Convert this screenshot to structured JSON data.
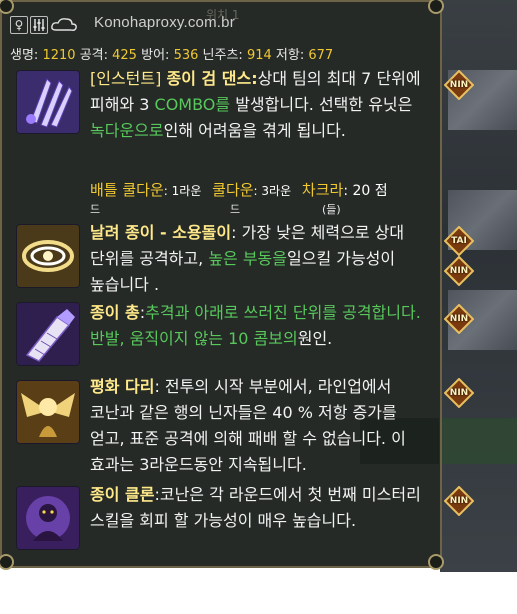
{
  "header": {
    "watermark": "Konohaproxy.com.br",
    "bg_title": "위치 1",
    "icons": [
      "female-icon",
      "equalizer-icon",
      "cloud-icon"
    ]
  },
  "stats": [
    {
      "label": "생명:",
      "value": "1210"
    },
    {
      "label": "공격:",
      "value": "425"
    },
    {
      "label": "방어:",
      "value": "536"
    },
    {
      "label": "닌주츠:",
      "value": "914"
    },
    {
      "label": "저항:",
      "value": "677"
    }
  ],
  "skills": [
    {
      "tag": "[인스턴트]",
      "name": "종이 검 댄스:",
      "text_a": "상대 팀의 최대 7 단위에 피해와 3 ",
      "hl_a": "COMBO를",
      "text_b": " 발생합니다. 선택한 유닛은 ",
      "hl_b": "녹다운으로",
      "text_c": "인해 어려움을 겪게 됩니다.",
      "badge": "NIN"
    },
    {
      "name": "날려 종이 - 소용돌이",
      "text_a": ": 가장 낮은 체력으로 상대 단위를 공격하고, ",
      "hl_a": "높은 부동을",
      "text_b": "일으킬 가능성이 높습니다 .",
      "badge_a": "TAI",
      "badge_b": "NIN"
    },
    {
      "name": "종이 총",
      "text_a": ":",
      "hl_a": "추격과 아래로 쓰러진 단위를 공격합니다. 반발, 움직이지 않는 10 콤보의",
      "text_b": "원인.",
      "badge": "NIN"
    },
    {
      "name": "평화 다리",
      "text_a": ": 전투의 시작 부분에서, 라인업에서 코난과 같은 행의 닌자들은 40 % 저항 증가를 얻고, 표준 공격에 의해 패배 할 수 없습니다. 이 효과는 3라운드동안 지속됩니다.",
      "badge": "NIN"
    },
    {
      "name": "종이 클론",
      "text_a": ":코난은 각 라운드에서 첫 번째 미스터리 스킬을 회피 할 가능성이 매우 높습니다.",
      "badge": "NIN"
    }
  ],
  "cooldown": {
    "battle_cd_label": "배틀 쿨다운",
    "battle_cd_value": ": 1라운",
    "battle_cd_sub": "드",
    "cd_label": "쿨다운",
    "cd_value": ": 3라운",
    "cd_sub": "드",
    "chakra_label": "차크라",
    "chakra_value": ": 20 점",
    "chakra_sub": "(들)"
  },
  "colors": {
    "panel_bg": "#141a16",
    "border": "#6d6447",
    "name": "#ffe98a",
    "highlight": "#58c85c",
    "number": "#f0c832"
  }
}
